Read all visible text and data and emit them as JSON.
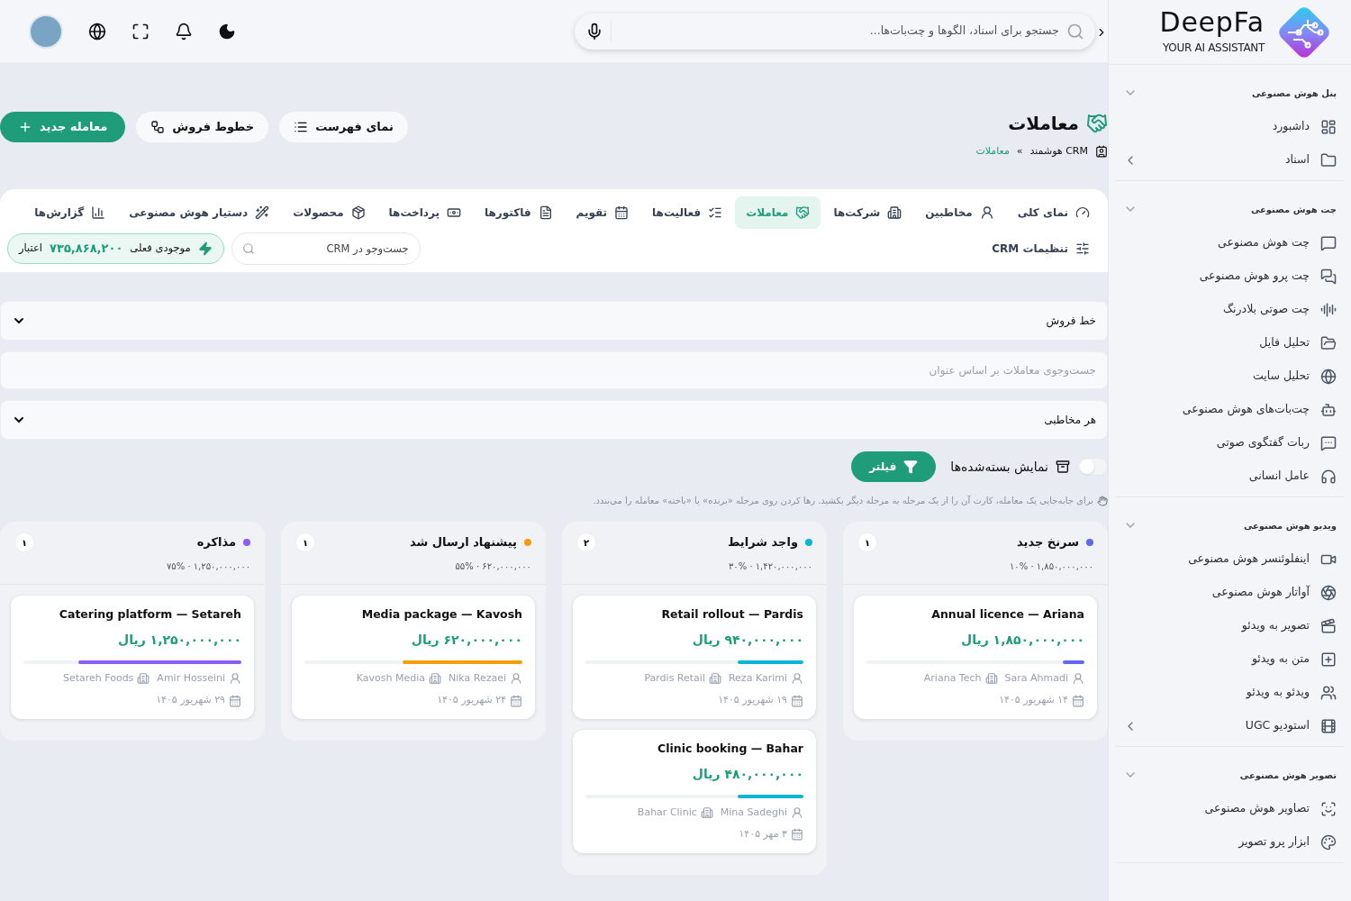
{
  "sidebar": {
    "logo": {
      "name": "DeepFa",
      "tagline": "YOUR AI ASSISTANT"
    },
    "sections": [
      {
        "title": "پنل هوش مصنوعی",
        "expanded": true,
        "items": [
          {
            "label": "داشبورد",
            "submenu": false
          },
          {
            "label": "اسناد",
            "submenu": true
          }
        ]
      },
      {
        "title": "چت هوش مصنوعی",
        "expanded": true,
        "items": [
          {
            "label": "چت هوش مصنوعی",
            "submenu": false
          },
          {
            "label": "چت پرو هوش مصنوعی",
            "submenu": false
          },
          {
            "label": "چت صوتی بلادرنگ",
            "submenu": false
          },
          {
            "label": "تحلیل فایل",
            "submenu": false
          },
          {
            "label": "تحلیل سایت",
            "submenu": false
          },
          {
            "label": "چت‌بات‌های هوش مصنوعی",
            "submenu": false
          },
          {
            "label": "ربات گفتگوی صوتی",
            "submenu": false
          },
          {
            "label": "عامل انسانی",
            "submenu": false
          }
        ]
      },
      {
        "title": "ویدیو هوش مصنوعی",
        "expanded": true,
        "items": [
          {
            "label": "اینفلوئنسر هوش مصنوعی",
            "submenu": false
          },
          {
            "label": "آواتار هوش مصنوعی",
            "submenu": false
          },
          {
            "label": "تصویر به ویدئو",
            "submenu": false
          },
          {
            "label": "متن به ویدئو",
            "submenu": false
          },
          {
            "label": "ویدئو به ویدئو",
            "submenu": false
          },
          {
            "label": "استودیو UGC",
            "submenu": true
          }
        ]
      },
      {
        "title": "تصویر هوش مصنوعی",
        "expanded": true,
        "items": [
          {
            "label": "تصاویر هوش مصنوعی",
            "submenu": false
          },
          {
            "label": "ابزار پرو تصویر",
            "submenu": false
          }
        ]
      }
    ]
  },
  "topbar": {
    "search": {
      "placeholder": "جستجو برای اسناد، الگوها و چت‌بات‌ها..."
    }
  },
  "page": {
    "title": "معاملات",
    "breadcrumb": [
      {
        "label": "CRM هوشمند",
        "current": false
      },
      {
        "label": "»",
        "current": false
      },
      {
        "label": "معاملات",
        "current": true
      }
    ],
    "actions": [
      {
        "label": "نمای فهرست",
        "kind": "list"
      },
      {
        "label": "خطوط فروش",
        "kind": "pipeline"
      },
      {
        "label": "معامله جدید",
        "kind": "primary"
      }
    ]
  },
  "tabs": [
    {
      "label": "نمای کلی",
      "selected": false
    },
    {
      "label": "مخاطبین",
      "selected": false
    },
    {
      "label": "شرکت‌ها",
      "selected": false
    },
    {
      "label": "معاملات",
      "selected": true
    },
    {
      "label": "فعالیت‌ها",
      "selected": false
    },
    {
      "label": "تقویم",
      "selected": false
    },
    {
      "label": "فاکتورها",
      "selected": false
    },
    {
      "label": "پرداخت‌ها",
      "selected": false
    },
    {
      "label": "محصولات",
      "selected": false
    },
    {
      "label": "دستیار هوش مصنوعی",
      "selected": false
    },
    {
      "label": "گزارش‌ها",
      "selected": false
    },
    {
      "label": "تنظیمات CRM",
      "selected": false
    }
  ],
  "crm_search": {
    "placeholder": "جست‌وجو در CRM"
  },
  "credit": {
    "label": "موجودی فعلی",
    "amount": "۷۳۵,۸۶۸,۲۰۰",
    "unit": "اعتبار"
  },
  "filters": {
    "pipeline": {
      "value": "خط فروش"
    },
    "title_search": {
      "placeholder": "جست‌وجوی معاملات بر اساس عنوان"
    },
    "contact": {
      "value": "هر مخاطبی"
    },
    "show_closed": {
      "label": "نمایش بسته‌شده‌ها",
      "on": false
    },
    "filter_button": "فیلتر",
    "hint": "برای جابه‌جایی یک معامله، کارت آن را از یک مرحله به مرحله دیگر بکشید. رها کردن روی مرحله «برنده» یا «باخته» معامله را می‌بندد."
  },
  "stages": [
    {
      "name": "سرنخ جدید",
      "color": "#6366f1",
      "count": "۱",
      "summary": "۱,۸۵۰,۰۰۰,۰۰۰ · ۱۰%",
      "deals": [
        {
          "title": "Annual licence — Ariana",
          "amount": "۱,۸۵۰,۰۰۰,۰۰۰ ریال",
          "level": 0.1,
          "contact": "Sara Ahmadi",
          "company": "Ariana Tech",
          "date": "۱۴ شهریور ۱۴۰۵"
        }
      ]
    },
    {
      "name": "واجد شرایط",
      "color": "#06b6d4",
      "count": "۲",
      "summary": "۱,۴۲۰,۰۰۰,۰۰۰ · ۳۰%",
      "deals": [
        {
          "title": "Retail rollout — Pardis",
          "amount": "۹۴۰,۰۰۰,۰۰۰ ریال",
          "level": 0.3,
          "contact": "Reza Karimi",
          "company": "Pardis Retail",
          "date": "۱۹ شهریور ۱۴۰۵"
        },
        {
          "title": "Clinic booking — Bahar",
          "amount": "۴۸۰,۰۰۰,۰۰۰ ریال",
          "level": 0.3,
          "contact": "Mina Sadeghi",
          "company": "Bahar Clinic",
          "date": "۳ مهر ۱۴۰۵"
        }
      ]
    },
    {
      "name": "پیشنهاد ارسال شد",
      "color": "#f59e0b",
      "count": "۱",
      "summary": "۶۲۰,۰۰۰,۰۰۰ · ۵۵%",
      "deals": [
        {
          "title": "Media package — Kavosh",
          "amount": "۶۲۰,۰۰۰,۰۰۰ ریال",
          "level": 0.55,
          "contact": "Nika Rezaei",
          "company": "Kavosh Media",
          "date": "۲۴ شهریور ۱۴۰۵"
        }
      ]
    },
    {
      "name": "مذاکره",
      "color": "#8b5cf6",
      "count": "۱",
      "summary": "۱,۲۵۰,۰۰۰,۰۰۰ · ۷۵%",
      "deals": [
        {
          "title": "Catering platform — Setareh",
          "amount": "۱,۲۵۰,۰۰۰,۰۰۰ ریال",
          "level": 0.75,
          "contact": "Amir Hosseini",
          "company": "Setareh Foods",
          "date": "۲۹ شهریور ۱۴۰۵"
        }
      ]
    }
  ]
}
